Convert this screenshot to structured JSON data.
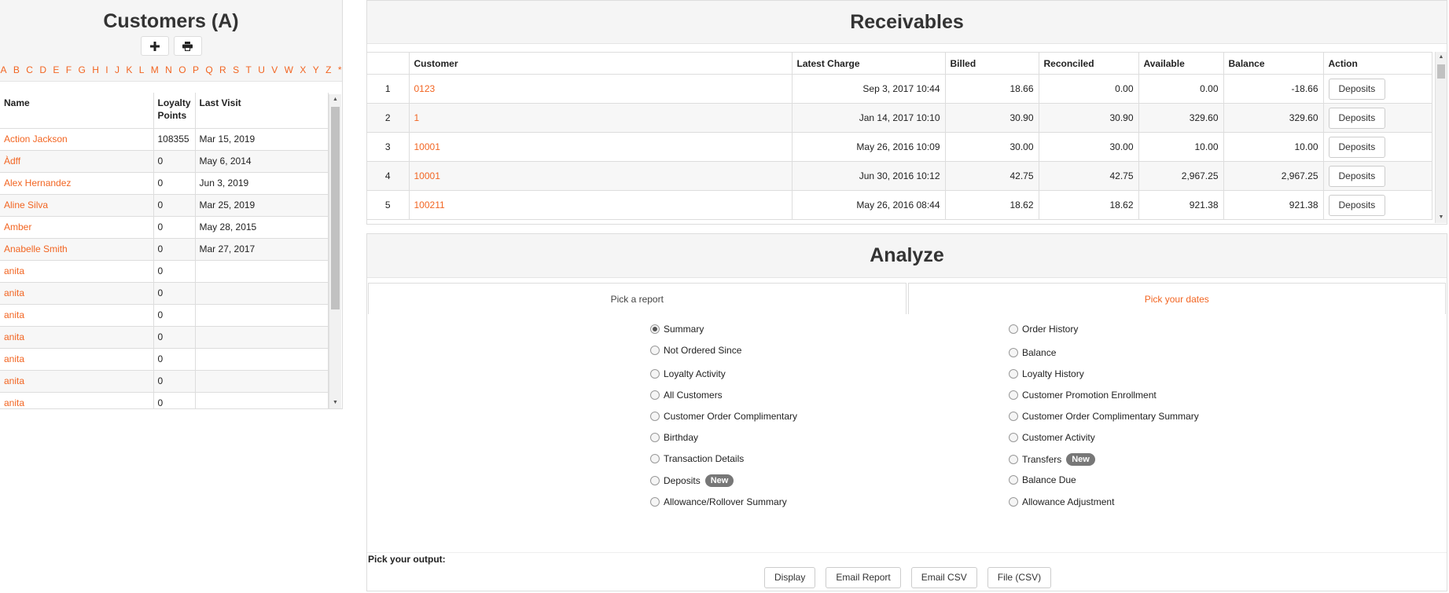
{
  "customers": {
    "title": "Customers (A)",
    "add_icon": "plus-icon",
    "print_icon": "print-icon",
    "alphabet": [
      "A",
      "B",
      "C",
      "D",
      "E",
      "F",
      "G",
      "H",
      "I",
      "J",
      "K",
      "L",
      "M",
      "N",
      "O",
      "P",
      "Q",
      "R",
      "S",
      "T",
      "U",
      "V",
      "W",
      "X",
      "Y",
      "Z",
      "*"
    ],
    "columns": [
      "Name",
      "Loyalty Points",
      "Last Visit"
    ],
    "rows": [
      {
        "name": "Action Jackson",
        "points": "108355",
        "last_visit": "Mar 15, 2019"
      },
      {
        "name": "Àdff",
        "points": "0",
        "last_visit": "May 6, 2014"
      },
      {
        "name": "Alex Hernandez",
        "points": "0",
        "last_visit": "Jun 3, 2019"
      },
      {
        "name": "Aline Silva",
        "points": "0",
        "last_visit": "Mar 25, 2019"
      },
      {
        "name": "Amber",
        "points": "0",
        "last_visit": "May 28, 2015"
      },
      {
        "name": "Anabelle Smith",
        "points": "0",
        "last_visit": "Mar 27, 2017"
      },
      {
        "name": "anita",
        "points": "0",
        "last_visit": ""
      },
      {
        "name": "anita",
        "points": "0",
        "last_visit": ""
      },
      {
        "name": "anita",
        "points": "0",
        "last_visit": ""
      },
      {
        "name": "anita",
        "points": "0",
        "last_visit": ""
      },
      {
        "name": "anita",
        "points": "0",
        "last_visit": ""
      },
      {
        "name": "anita",
        "points": "0",
        "last_visit": ""
      },
      {
        "name": "anita",
        "points": "0",
        "last_visit": ""
      }
    ]
  },
  "receivables": {
    "title": "Receivables",
    "columns": [
      "",
      "Customer",
      "Latest Charge",
      "Billed",
      "Reconciled",
      "Available",
      "Balance",
      "Action"
    ],
    "rows": [
      {
        "idx": "1",
        "customer": "0123",
        "latest": "Sep 3, 2017 10:44",
        "billed": "18.66",
        "reconciled": "0.00",
        "available": "0.00",
        "balance": "-18.66",
        "action": "Deposits"
      },
      {
        "idx": "2",
        "customer": "1",
        "latest": "Jan 14, 2017 10:10",
        "billed": "30.90",
        "reconciled": "30.90",
        "available": "329.60",
        "balance": "329.60",
        "action": "Deposits"
      },
      {
        "idx": "3",
        "customer": "10001",
        "latest": "May 26, 2016 10:09",
        "billed": "30.00",
        "reconciled": "30.00",
        "available": "10.00",
        "balance": "10.00",
        "action": "Deposits"
      },
      {
        "idx": "4",
        "customer": "10001",
        "latest": "Jun 30, 2016 10:12",
        "billed": "42.75",
        "reconciled": "42.75",
        "available": "2,967.25",
        "balance": "2,967.25",
        "action": "Deposits"
      },
      {
        "idx": "5",
        "customer": "100211",
        "latest": "May 26, 2016 08:44",
        "billed": "18.62",
        "reconciled": "18.62",
        "available": "921.38",
        "balance": "921.38",
        "action": "Deposits"
      }
    ]
  },
  "analyze": {
    "title": "Analyze",
    "tabs": [
      "Pick a report",
      "Pick your dates"
    ],
    "left_options": [
      {
        "label": "Summary",
        "checked": true,
        "badge": ""
      },
      {
        "label": "Not Ordered Since",
        "checked": false,
        "badge": ""
      },
      {
        "label": "Loyalty Activity",
        "checked": false,
        "badge": ""
      },
      {
        "label": "All Customers",
        "checked": false,
        "badge": ""
      },
      {
        "label": "Customer Order Complimentary",
        "checked": false,
        "badge": ""
      },
      {
        "label": "Birthday",
        "checked": false,
        "badge": ""
      },
      {
        "label": "Transaction Details",
        "checked": false,
        "badge": ""
      },
      {
        "label": "Deposits",
        "checked": false,
        "badge": "New"
      },
      {
        "label": "Allowance/Rollover Summary",
        "checked": false,
        "badge": ""
      }
    ],
    "right_options": [
      {
        "label": "Order History",
        "checked": false,
        "badge": ""
      },
      {
        "label": "Balance",
        "checked": false,
        "badge": ""
      },
      {
        "label": "Loyalty History",
        "checked": false,
        "badge": ""
      },
      {
        "label": "Customer Promotion Enrollment",
        "checked": false,
        "badge": ""
      },
      {
        "label": "Customer Order Complimentary Summary",
        "checked": false,
        "badge": ""
      },
      {
        "label": "Customer Activity",
        "checked": false,
        "badge": ""
      },
      {
        "label": "Transfers",
        "checked": false,
        "badge": "New"
      },
      {
        "label": "Balance Due",
        "checked": false,
        "badge": ""
      },
      {
        "label": "Allowance Adjustment",
        "checked": false,
        "badge": ""
      }
    ],
    "output_label": "Pick your output:",
    "output_buttons": [
      "Display",
      "Email Report",
      "Email CSV",
      "File (CSV)"
    ]
  },
  "colors": {
    "accent": "#f26522",
    "badge": "#777777",
    "header_bg": "#f5f5f5"
  }
}
